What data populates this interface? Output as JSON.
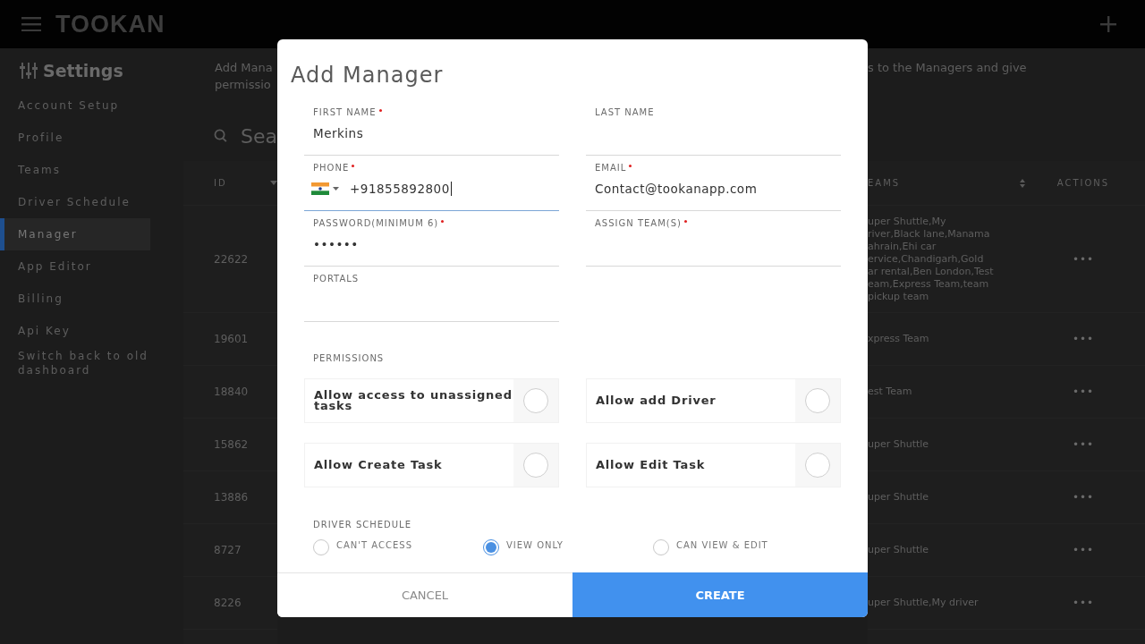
{
  "app": {
    "logo": "TOOKAN"
  },
  "sidebar": {
    "title": "Settings",
    "items": [
      {
        "label": "Account Setup",
        "selected": false
      },
      {
        "label": "Profile",
        "selected": false
      },
      {
        "label": "Teams",
        "selected": false
      },
      {
        "label": "Driver Schedule",
        "selected": false
      },
      {
        "label": "Manager",
        "selected": true
      },
      {
        "label": "App Editor",
        "selected": false
      },
      {
        "label": "Billing",
        "selected": false
      },
      {
        "label": "Api Key",
        "selected": false
      },
      {
        "label": "Switch back to old dashboard",
        "selected": false
      }
    ]
  },
  "page": {
    "intro_left": [
      "Add Mana",
      "permissio"
    ],
    "intro_right": "s to the Managers and give",
    "search": {
      "placeholder": "Sea"
    },
    "table": {
      "columns": [
        "ID",
        "EAMS",
        "ACTIONS"
      ],
      "rows": [
        {
          "id": "22622",
          "teams": "uper Shuttle,My\nriver,Black lane,Manama\nahrain,Ehi car\nervice,Chandigarh,Gold\nar rental,Ben London,Test\neam,Express Team,team\npickup team",
          "actions": "•••"
        },
        {
          "id": "19601",
          "teams": "xpress Team",
          "actions": "•••"
        },
        {
          "id": "18840",
          "teams": "est Team",
          "actions": "•••"
        },
        {
          "id": "15862",
          "teams": "uper Shuttle",
          "actions": "•••"
        },
        {
          "id": "13886",
          "teams": "uper Shuttle",
          "actions": "•••"
        },
        {
          "id": "8727",
          "teams": "uper Shuttle",
          "actions": "•••"
        },
        {
          "id": "8226",
          "teams": "uper Shuttle,My driver",
          "actions": "•••"
        }
      ]
    }
  },
  "dialog": {
    "title": "Add Manager",
    "fields": [
      {
        "kind": "text",
        "label": "FIRST NAME",
        "required": true,
        "value": "Merkins",
        "focused": false
      },
      {
        "kind": "text",
        "label": "LAST NAME",
        "required": false,
        "focused": false
      },
      {
        "kind": "phone",
        "label": "PHONE",
        "required": true,
        "value": "+91855892800",
        "focused": true
      },
      {
        "kind": "text",
        "label": "EMAIL",
        "required": true,
        "value": "Contact@tookanapp.com",
        "focused": false
      },
      {
        "kind": "text",
        "label": "PASSWORD(MINIMUM 6)",
        "required": true,
        "value": "••••••",
        "focused": false
      },
      {
        "kind": "text",
        "label": "ASSIGN TEAM(S)",
        "required": true,
        "focused": false
      },
      {
        "kind": "text",
        "label": "PORTALS",
        "required": false,
        "focused": false
      }
    ],
    "permissions_label": "PERMISSIONS",
    "permissions": [
      {
        "label": "Allow access to unassigned tasks",
        "checked": false
      },
      {
        "label": "Allow add Driver",
        "checked": false
      },
      {
        "label": "Allow Create Task",
        "checked": false
      },
      {
        "label": "Allow Edit Task",
        "checked": false
      }
    ],
    "schedule_label": "DRIVER SCHEDULE",
    "schedule_options": [
      {
        "label": "CAN'T ACCESS",
        "selected": false
      },
      {
        "label": "VIEW ONLY",
        "selected": true
      },
      {
        "label": "CAN VIEW & EDIT",
        "selected": false
      }
    ],
    "buttons": [
      {
        "kind": "secondary",
        "label": "CANCEL"
      },
      {
        "kind": "primary",
        "label": "CREATE"
      }
    ]
  }
}
